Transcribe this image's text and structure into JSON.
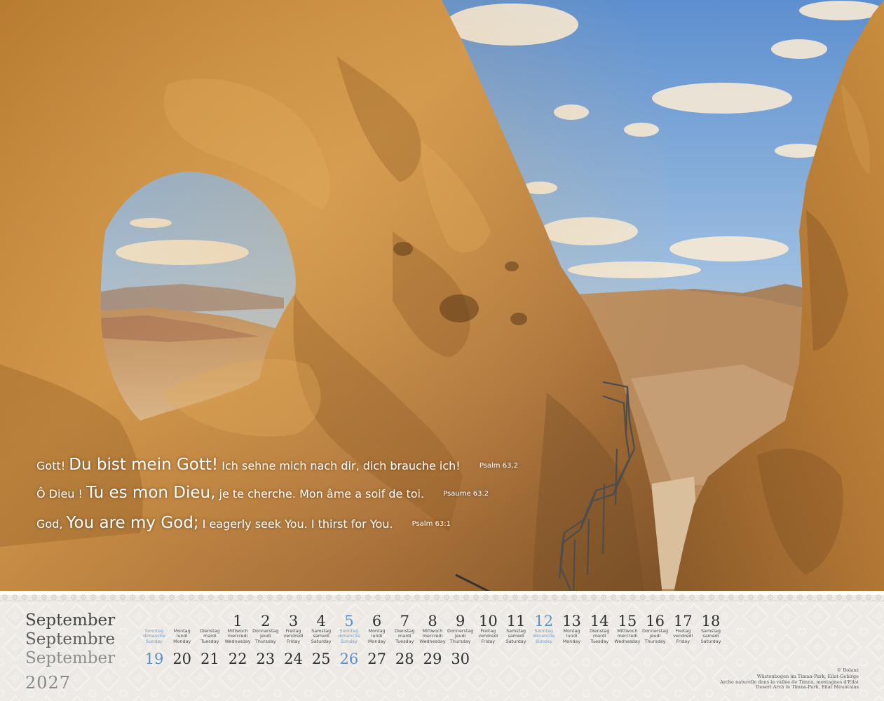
{
  "quotes": [
    {
      "prefix": "Gott!",
      "emphasis": "Du bist mein Gott!",
      "rest": "Ich sehne mich nach dir, dich brauche ich!",
      "ref": "Psalm 63,2"
    },
    {
      "prefix": "Ô Dieu !",
      "emphasis": "Tu es mon Dieu,",
      "rest": "je te cherche. Mon âme a soif de toi.",
      "ref": "Psaume 63.2"
    },
    {
      "prefix": "God,",
      "emphasis": "You are my God;",
      "rest": "I eagerly seek You. I thirst for You.",
      "ref": "Psalm 63:1"
    }
  ],
  "calendar": {
    "month_de": "September",
    "month_fr": "Septembre",
    "month_en": "September",
    "year": "2027",
    "sunday_color": "#5a8fc4",
    "row1": [
      {
        "num": "",
        "de": "Sonntag",
        "fr": "dimanche",
        "en": "Sunday",
        "sun": true
      },
      {
        "num": "",
        "de": "Montag",
        "fr": "lundi",
        "en": "Monday"
      },
      {
        "num": "",
        "de": "Dienstag",
        "fr": "mardi",
        "en": "Tuesday"
      },
      {
        "num": "1",
        "de": "Mittwoch",
        "fr": "mercredi",
        "en": "Wednesday"
      },
      {
        "num": "2",
        "de": "Donnerstag",
        "fr": "jeudi",
        "en": "Thursday"
      },
      {
        "num": "3",
        "de": "Freitag",
        "fr": "vendredi",
        "en": "Friday"
      },
      {
        "num": "4",
        "de": "Samstag",
        "fr": "samedi",
        "en": "Saturday"
      },
      {
        "num": "5",
        "de": "Sonntag",
        "fr": "dimanche",
        "en": "Sunday",
        "sun": true
      },
      {
        "num": "6",
        "de": "Montag",
        "fr": "lundi",
        "en": "Monday"
      },
      {
        "num": "7",
        "de": "Dienstag",
        "fr": "mardi",
        "en": "Tuesday"
      },
      {
        "num": "8",
        "de": "Mittwoch",
        "fr": "mercredi",
        "en": "Wednesday"
      },
      {
        "num": "9",
        "de": "Donnerstag",
        "fr": "jeudi",
        "en": "Thursday"
      },
      {
        "num": "10",
        "de": "Freitag",
        "fr": "vendredi",
        "en": "Friday"
      },
      {
        "num": "11",
        "de": "Samstag",
        "fr": "samedi",
        "en": "Saturday"
      },
      {
        "num": "12",
        "de": "Sonntag",
        "fr": "dimanche",
        "en": "Sunday",
        "sun": true
      },
      {
        "num": "13",
        "de": "Montag",
        "fr": "lundi",
        "en": "Monday"
      },
      {
        "num": "14",
        "de": "Dienstag",
        "fr": "mardi",
        "en": "Tuesday"
      },
      {
        "num": "15",
        "de": "Mittwoch",
        "fr": "mercredi",
        "en": "Wednesday"
      },
      {
        "num": "16",
        "de": "Donnerstag",
        "fr": "jeudi",
        "en": "Thursday"
      },
      {
        "num": "17",
        "de": "Freitag",
        "fr": "vendredi",
        "en": "Friday"
      },
      {
        "num": "18",
        "de": "Samstag",
        "fr": "samedi",
        "en": "Saturday"
      }
    ],
    "row2": [
      {
        "num": "19",
        "sun": true
      },
      {
        "num": "20"
      },
      {
        "num": "21"
      },
      {
        "num": "22"
      },
      {
        "num": "23"
      },
      {
        "num": "24"
      },
      {
        "num": "25"
      },
      {
        "num": "26",
        "sun": true
      },
      {
        "num": "27"
      },
      {
        "num": "28"
      },
      {
        "num": "29"
      },
      {
        "num": "30"
      }
    ],
    "copyright": "© Bolanz",
    "caption_de": "Wüstenbogen im Timna-Park, Eilat-Gebirge",
    "caption_fr": "Arche naturelle dans la vallée de Timna, montagnes d'Eilat",
    "caption_en": "Desert Arch in Timna-Park, Eilat Mountains"
  }
}
